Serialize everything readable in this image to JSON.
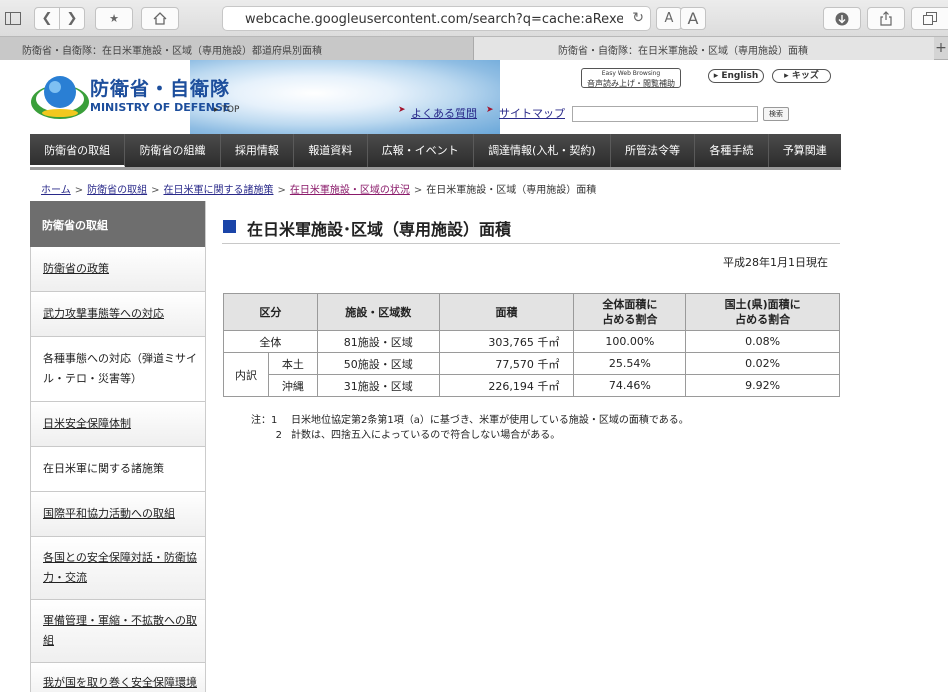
{
  "browser": {
    "url": "webcache.googleusercontent.com/search?q=cache:aRexelq0m_k...",
    "reader_small": "A",
    "reader_large": "A",
    "tabs": [
      {
        "title": "防衛省・自衛隊：在日米軍施設・区域（専用施設）都道府県別面積"
      },
      {
        "title": "防衛省・自衛隊：在日米軍施設・区域（専用施設）面積"
      }
    ]
  },
  "header": {
    "logo_ja": "防衛省・自衛隊",
    "logo_en": "MINISTRY OF DEFENSE",
    "top_link": "▸ TOP",
    "ewb_line1": "Easy Web Browsing",
    "ewb_line2": "音声読み上げ・閲覧補助",
    "english": "▸ English",
    "kids": "▸ キッズ",
    "faq": "よくある質問",
    "sitemap": "サイトマップ",
    "search_button": "検索"
  },
  "gnav": [
    "防衛省の取組",
    "防衛省の組織",
    "採用情報",
    "報道資料",
    "広報・イベント",
    "調達情報(入札・契約)",
    "所管法令等",
    "各種手続",
    "予算関連"
  ],
  "breadcrumb": [
    "ホーム",
    "防衛省の取組",
    "在日米軍に関する諸施策",
    "在日米軍施設・区域の状況",
    "在日米軍施設・区域（専用施設）面積"
  ],
  "sidebar": {
    "heading": "防衛省の取組",
    "items": [
      "防衛省の政策",
      "武力攻撃事態等への対応",
      "各種事態への対応（弾道ミサイル・テロ・災害等）",
      "日米安全保障体制",
      "在日米軍に関する諸施策",
      "国際平和協力活動への取組",
      "各国との安全保障対話・防衛協力・交流",
      "軍備管理・軍縮・不拡散への取組",
      "我が国を取り巻く安全保障環境"
    ]
  },
  "main": {
    "title": "在日米軍施設･区域（専用施設）面積",
    "as_of": "平成28年1月1日現在",
    "table": {
      "headers": [
        "区分",
        "施設・区域数",
        "面積",
        "全体面積に\n占める割合",
        "国土(県)面積に\n占める割合"
      ],
      "breakdown_label": "内訳",
      "rows": [
        {
          "label": "全体",
          "count": "81施設・区域",
          "area": "303,765 千㎡",
          "share_total": "100.00%",
          "share_land": "0.08%"
        },
        {
          "label": "本土",
          "count": "50施設・区域",
          "area": "77,570 千㎡",
          "share_total": "25.54%",
          "share_land": "0.02%"
        },
        {
          "label": "沖縄",
          "count": "31施設・区域",
          "area": "226,194 千㎡",
          "share_total": "74.46%",
          "share_land": "9.92%"
        }
      ]
    },
    "notes": [
      {
        "idx": "注：1",
        "text": "日米地位協定第2条第1項（a）に基づき、米軍が使用している施設・区域の面積である。"
      },
      {
        "idx": "2",
        "text": "計数は、四捨五入によっているので符合しない場合がある。"
      }
    ]
  }
}
